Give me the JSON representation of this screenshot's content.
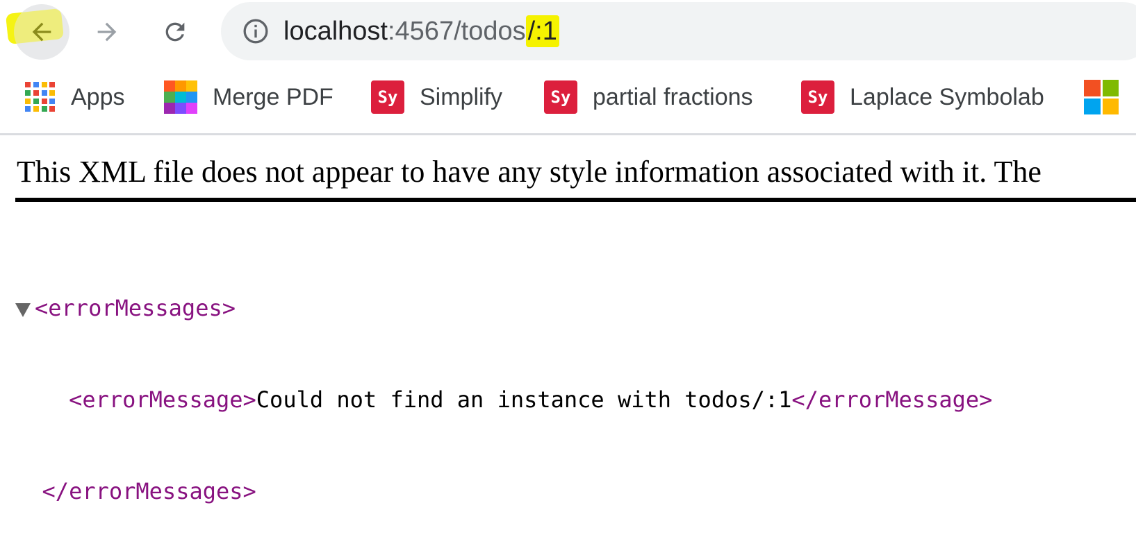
{
  "toolbar": {
    "back_icon": "arrow-left-icon",
    "forward_icon": "arrow-right-icon",
    "reload_icon": "reload-icon",
    "info_icon": "info-circle-icon",
    "url_host": "localhost",
    "url_path": ":4567/todos",
    "url_highlighted": "/:1"
  },
  "bookmarks": [
    {
      "label": "Apps",
      "icon": "apps-grid-icon"
    },
    {
      "label": "Merge PDF",
      "icon": "merge-pdf-icon"
    },
    {
      "label": "Simplify",
      "icon": "symbolab-icon",
      "icon_text": "Sy"
    },
    {
      "label": "partial fractions",
      "icon": "symbolab-icon",
      "icon_text": "Sy"
    },
    {
      "label": "Laplace Symbolab",
      "icon": "symbolab-icon",
      "icon_text": "Sy"
    },
    {
      "label": "",
      "icon": "microsoft-icon"
    }
  ],
  "content": {
    "notice": "This XML file does not appear to have any style information associated with it. The",
    "xml": {
      "root_open": "<errorMessages>",
      "child_open": "<errorMessage>",
      "child_text": "Could not find an instance with todos/:1",
      "child_close": "</errorMessage>",
      "root_close": "</errorMessages>"
    }
  },
  "colors": {
    "highlight": "#f5f200",
    "xml_tag": "#881280",
    "symbolab_red": "#dc1f3d"
  }
}
